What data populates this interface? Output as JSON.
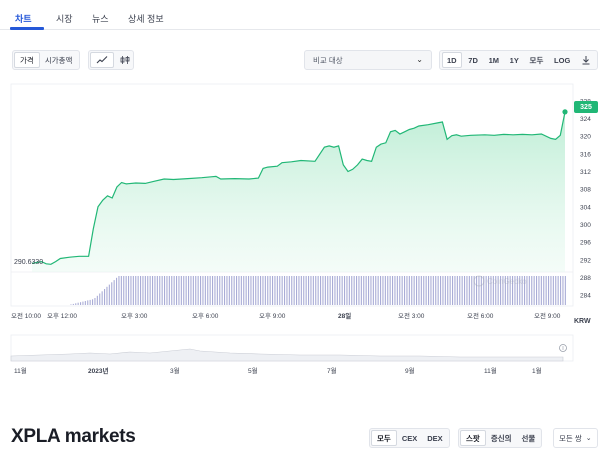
{
  "tabs": [
    {
      "label": "차트",
      "active": true
    },
    {
      "label": "시장",
      "active": false
    },
    {
      "label": "뉴스",
      "active": false
    },
    {
      "label": "상세 정보",
      "active": false
    }
  ],
  "toolbar": {
    "metric_options": [
      "가격",
      "시가총액"
    ],
    "metric_selected": "가격",
    "chart_style_icons": [
      "line-chart-icon",
      "candlestick-icon"
    ],
    "compare_placeholder": "비교 대상",
    "ranges": [
      "1D",
      "7D",
      "1M",
      "1Y",
      "모두",
      "LOG"
    ],
    "range_selected": "1D",
    "download_icon": "download-icon"
  },
  "colors": {
    "accent": "#2558d8",
    "price_line": "#21b776",
    "price_area_top": "#bfeed6",
    "volume_bar": "#a9acd6"
  },
  "main_chart": {
    "currency": "KRW",
    "current_price": "325",
    "start_price_label": "290.6330",
    "watermark": "CoinGecko",
    "y_ticks": [
      "328",
      "324",
      "320",
      "316",
      "312",
      "308",
      "304",
      "300",
      "296",
      "292",
      "288",
      "284"
    ],
    "x_ticks": [
      "오전 10:00",
      "오후 12:00",
      "오후 3:00",
      "오후 6:00",
      "오후 9:00",
      "28일",
      "오전 3:00",
      "오전 6:00",
      "오전 9:00"
    ],
    "ylim": [
      282,
      330
    ],
    "price_series": [
      [
        0,
        291.2
      ],
      [
        2,
        291.6
      ],
      [
        3,
        291.1
      ],
      [
        4,
        291.0
      ],
      [
        5,
        291.6
      ],
      [
        6,
        292.3
      ],
      [
        8,
        292.6
      ],
      [
        10,
        292.8
      ],
      [
        12,
        292.8
      ],
      [
        13,
        299
      ],
      [
        14,
        304
      ],
      [
        15,
        305.5
      ],
      [
        16,
        306.5
      ],
      [
        17,
        306
      ],
      [
        18,
        308.5
      ],
      [
        19,
        309.5
      ],
      [
        20,
        309.2
      ],
      [
        22,
        309.4
      ],
      [
        24,
        309.3
      ],
      [
        26,
        309.8
      ],
      [
        28,
        310.3
      ],
      [
        30,
        310.2
      ],
      [
        33,
        310.4
      ],
      [
        36,
        310.6
      ],
      [
        38,
        310.8
      ],
      [
        39,
        310.9
      ],
      [
        40,
        310.3
      ],
      [
        43,
        310.4
      ],
      [
        46,
        310.3
      ],
      [
        48,
        310.5
      ],
      [
        49,
        312.7
      ],
      [
        50,
        313.0
      ],
      [
        52,
        313.2
      ],
      [
        53,
        314.0
      ],
      [
        55,
        314.2
      ],
      [
        57,
        314.5
      ],
      [
        60,
        314.3
      ],
      [
        62,
        317.5
      ],
      [
        63,
        317.8
      ],
      [
        64,
        317.5
      ],
      [
        65,
        317.8
      ],
      [
        66,
        313.5
      ],
      [
        67,
        312.0
      ],
      [
        68,
        312.5
      ],
      [
        69,
        313.5
      ],
      [
        70,
        314.8
      ],
      [
        71,
        314.5
      ],
      [
        72,
        314.3
      ],
      [
        73,
        317.5
      ],
      [
        74,
        318.2
      ],
      [
        75,
        318.5
      ],
      [
        76,
        321.0
      ],
      [
        77,
        321.3
      ],
      [
        78,
        320.5
      ],
      [
        79,
        321.0
      ],
      [
        80,
        321.5
      ],
      [
        81,
        321.8
      ],
      [
        82,
        322.3
      ],
      [
        84,
        322.6
      ],
      [
        86,
        323.0
      ],
      [
        87,
        323.2
      ],
      [
        88,
        319.3
      ],
      [
        89,
        320.1
      ],
      [
        90,
        320.3
      ],
      [
        91,
        320.0
      ],
      [
        93,
        320.2
      ],
      [
        96,
        320.3
      ],
      [
        98,
        320.2
      ],
      [
        100,
        320.4
      ],
      [
        102,
        320.3
      ],
      [
        104,
        320.4
      ],
      [
        106,
        320.3
      ],
      [
        108,
        320.5
      ],
      [
        110,
        319.5
      ],
      [
        111,
        319.3
      ],
      [
        112,
        320.2
      ],
      [
        113,
        325.5
      ]
    ],
    "volume_start_index": 13
  },
  "overview": {
    "x_ticks": [
      "11월",
      "2023년",
      "3월",
      "5월",
      "7월",
      "9월",
      "11월",
      "1월"
    ]
  },
  "markets": {
    "title": "XPLA markets",
    "exchange_filters": [
      "모두",
      "CEX",
      "DEX"
    ],
    "exchange_selected": "모두",
    "type_filters": [
      "스팟",
      "증신의",
      "선물"
    ],
    "type_selected": "스팟",
    "pairs_label": "모든 쌍"
  }
}
